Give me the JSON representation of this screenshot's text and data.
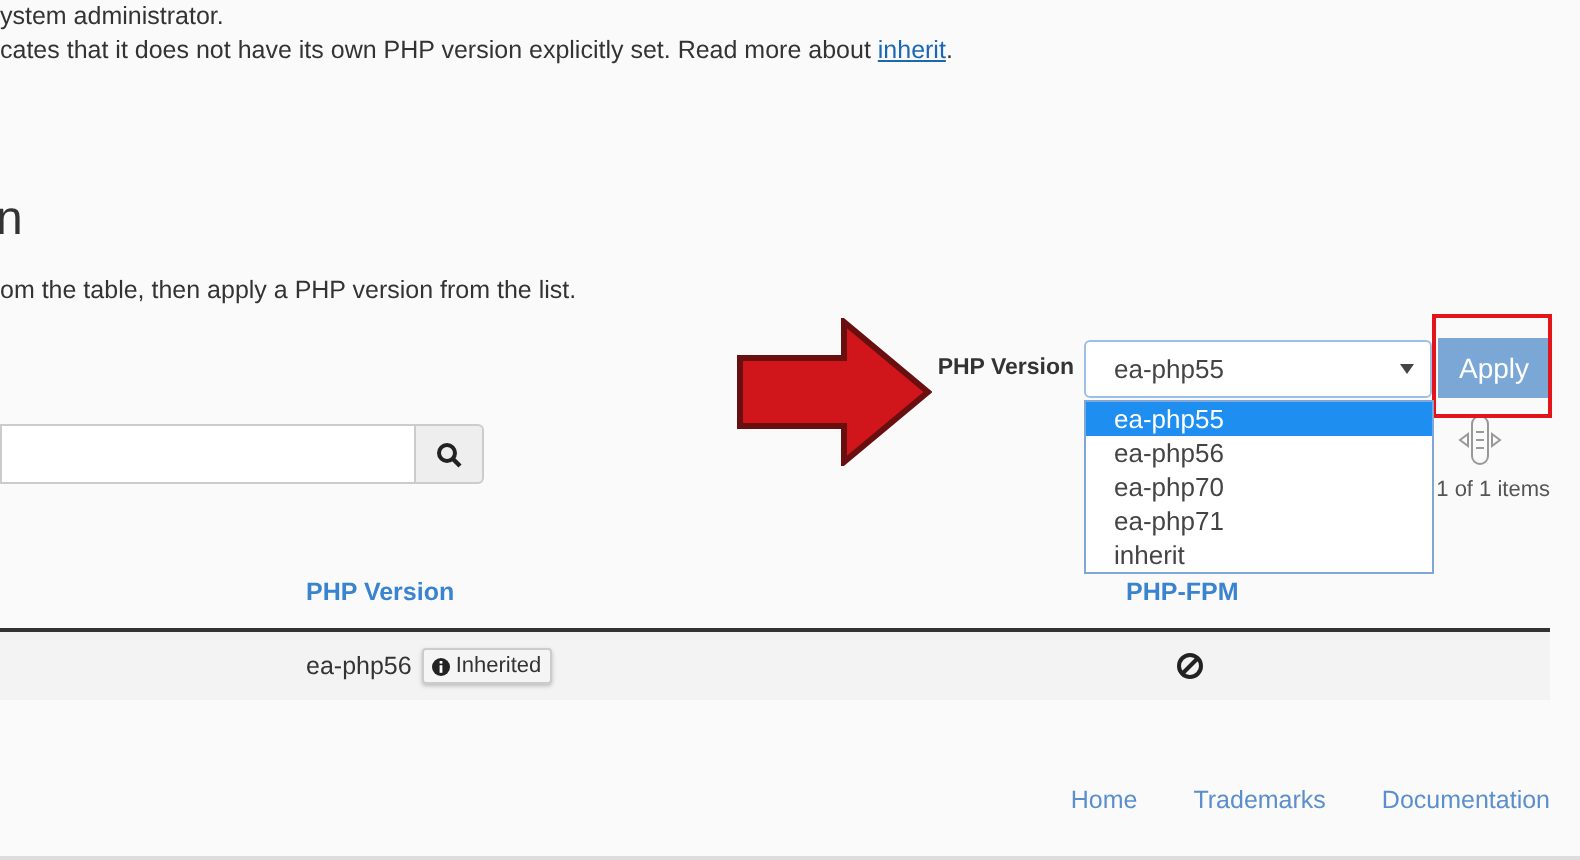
{
  "notice_lines": [
    {
      "text": "ystem administrator."
    },
    {
      "text": "cates that it does not have its own PHP version explicitly set. Read more about ",
      "link": "inherit",
      "after": "."
    }
  ],
  "heading": "n",
  "instruction": "om the table, then apply a PHP version from the list.",
  "version_selector": {
    "label": "PHP Version",
    "value": "ea-php55",
    "expanded": true,
    "apply": "Apply",
    "options": [
      {
        "label": "ea-php55",
        "selected": true
      },
      {
        "label": "ea-php56",
        "selected": false
      },
      {
        "label": "ea-php70",
        "selected": false
      },
      {
        "label": "ea-php71",
        "selected": false
      },
      {
        "label": "inherit",
        "selected": false
      }
    ]
  },
  "pagination": {
    "summary": "1 of 1 items"
  },
  "table": {
    "columns": [
      "PHP Version",
      "PHP-FPM"
    ],
    "rows": [
      {
        "php_version": "ea-php56",
        "badge": "Inherited",
        "fpm_enabled": false
      }
    ]
  },
  "footer_links": [
    "Home",
    "Trademarks",
    "Documentation"
  ]
}
